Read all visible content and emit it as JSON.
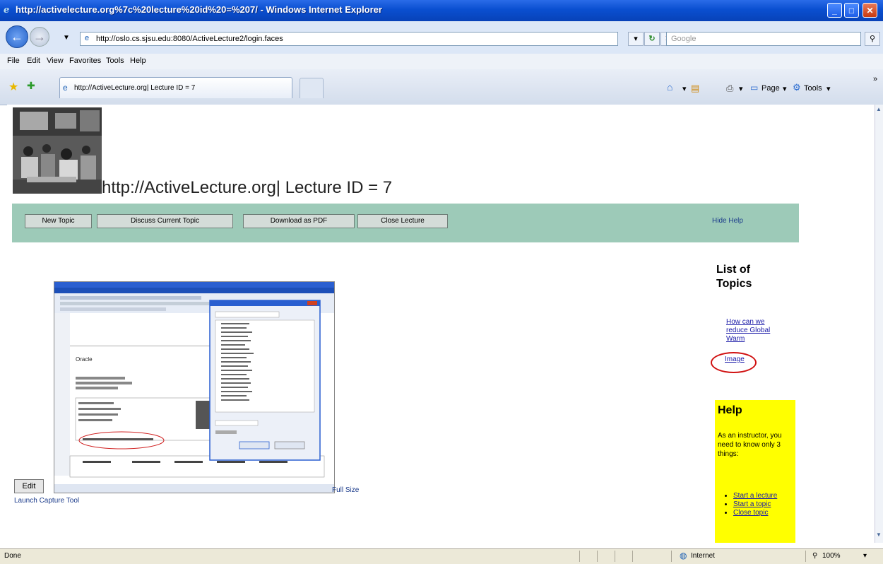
{
  "window": {
    "title": "http://activelecture.org%7c%20lecture%20id%20=%207/ - Windows Internet Explorer"
  },
  "address": {
    "url": "http://oslo.cs.sjsu.edu:8080/ActiveLecture2/login.faces"
  },
  "search": {
    "placeholder": "Google"
  },
  "menu": [
    "File",
    "Edit",
    "View",
    "Favorites",
    "Tools",
    "Help"
  ],
  "tab": {
    "title": "http://ActiveLecture.org| Lecture ID = 7"
  },
  "toolbar": {
    "page_label": "Page",
    "tools_label": "Tools"
  },
  "page": {
    "heading": "http://ActiveLecture.org| Lecture ID = 7",
    "buttons": [
      "New Topic",
      "Discuss Current Topic",
      "Download as PDF",
      "Close Lecture"
    ],
    "hide_help": "Hide Help",
    "topics_heading": "List of Topics",
    "topic_link": "How can we reduce Global Warm",
    "image_link": "Image",
    "help": {
      "title": "Help",
      "intro": "As an instructor, you need to know only 3 things:",
      "items": [
        "Start a lecture",
        "Start a topic",
        "Close topic"
      ]
    },
    "edit_label": "Edit",
    "launch_label": "Launch Capture Tool",
    "full_size_label": "Full Size",
    "capture_caption": "Oracle"
  },
  "status": {
    "left": "Done",
    "zone": "Internet",
    "zoom": "100%"
  }
}
